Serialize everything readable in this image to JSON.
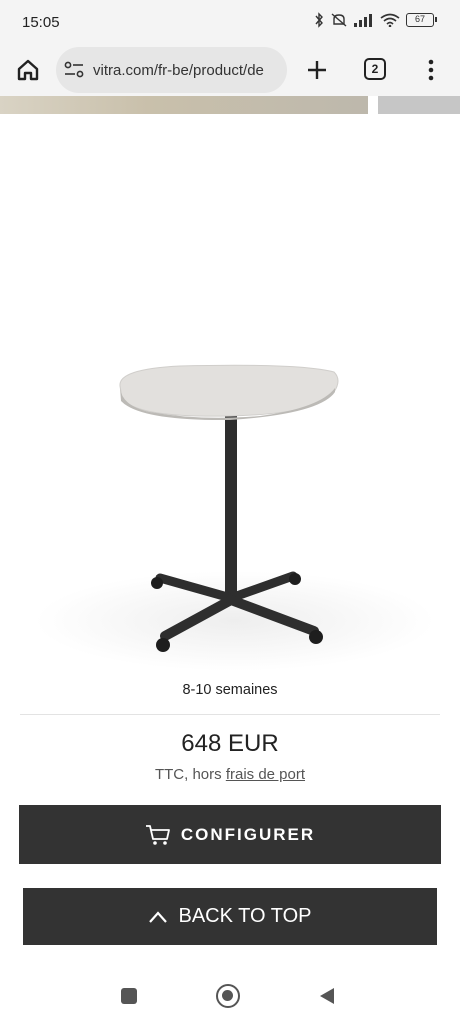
{
  "status_bar": {
    "time": "15:05",
    "battery": "67"
  },
  "browser": {
    "url": "vitra.com/fr-be/product/de",
    "tab_count": "2"
  },
  "product": {
    "delivery": "8-10 semaines",
    "price": "648 EUR",
    "tax_prefix": "TTC, hors",
    "tax_link": "frais de port"
  },
  "actions": {
    "configure_label": "CONFIGURER",
    "back_to_top_label": "BACK TO TOP"
  },
  "colors": {
    "button_bg": "#333333",
    "tabletop": "#e2e0dd",
    "frame": "#2e2e2e"
  }
}
